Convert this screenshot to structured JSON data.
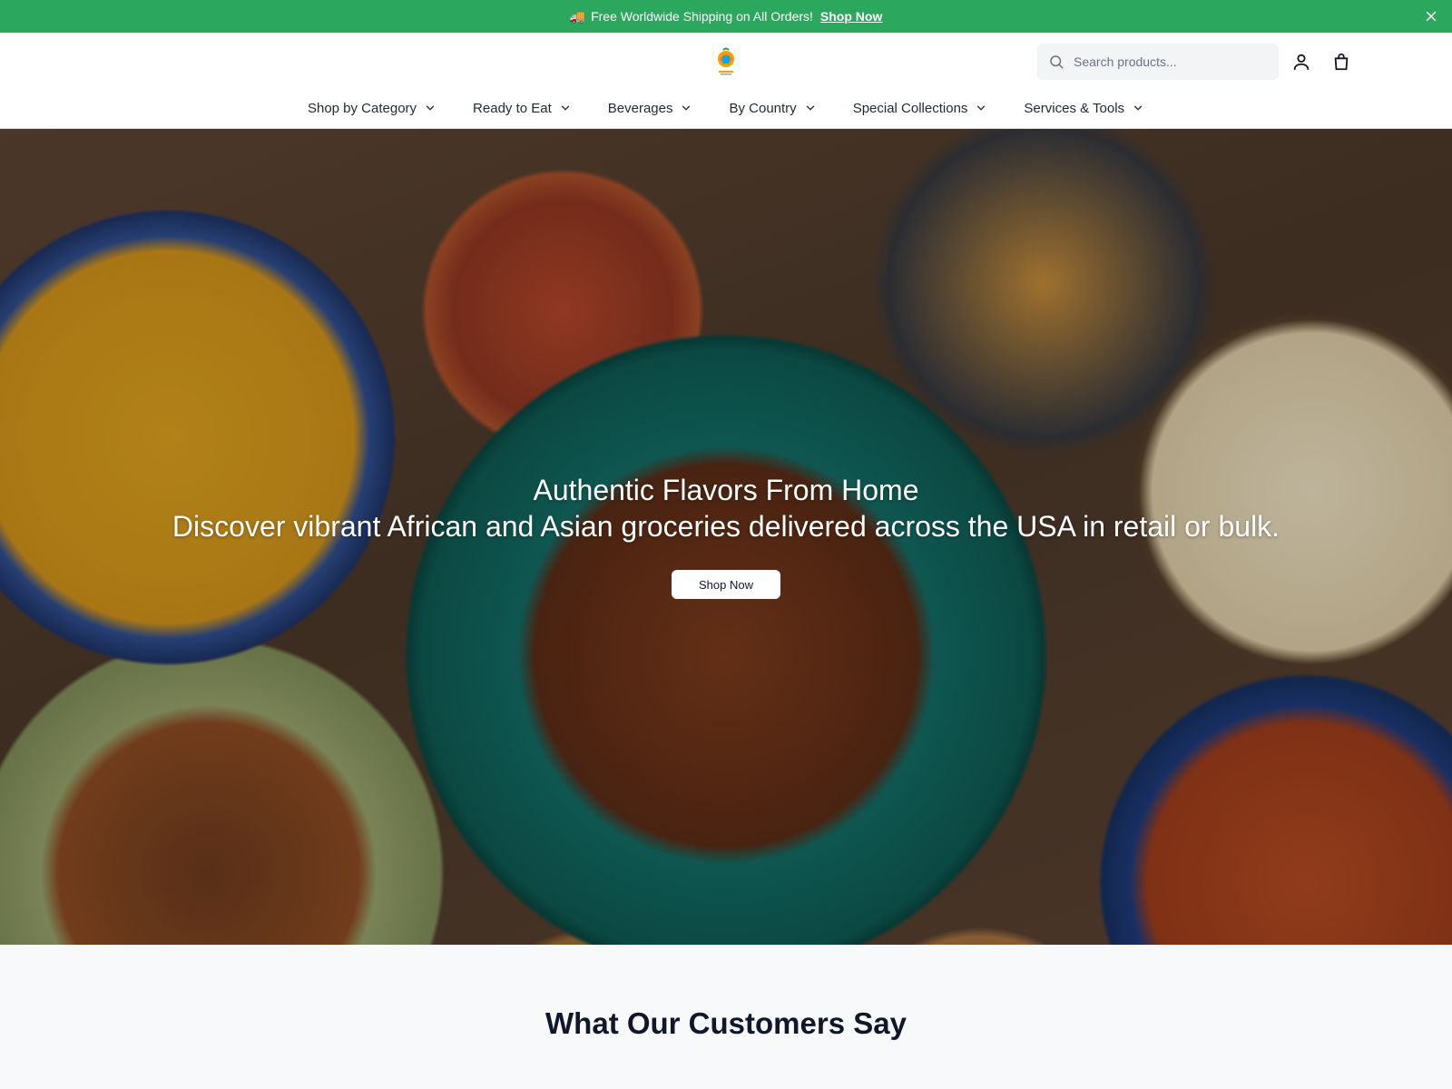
{
  "announcement": {
    "emoji": "🚚",
    "text": "Free Worldwide Shipping on All Orders!",
    "link": "Shop Now"
  },
  "header": {
    "search_placeholder": "Search products...",
    "nav": [
      {
        "label": "Shop by Category"
      },
      {
        "label": "Ready to Eat"
      },
      {
        "label": "Beverages"
      },
      {
        "label": "By Country"
      },
      {
        "label": "Special Collections"
      },
      {
        "label": "Services & Tools"
      }
    ]
  },
  "hero": {
    "title": "Authentic Flavors From Home",
    "subtitle": "Discover vibrant African and Asian groceries delivered across the USA in retail or bulk.",
    "button": "Shop Now"
  },
  "testimonials": {
    "heading": "What Our Customers Say"
  },
  "colors": {
    "brand_green": "#2ba85d",
    "text_dark": "#1f2937"
  },
  "icons": {
    "search": "search-icon",
    "account": "user-icon",
    "cart": "shopping-bag-icon",
    "close": "close-icon",
    "dropdown": "chevron-down-icon"
  }
}
